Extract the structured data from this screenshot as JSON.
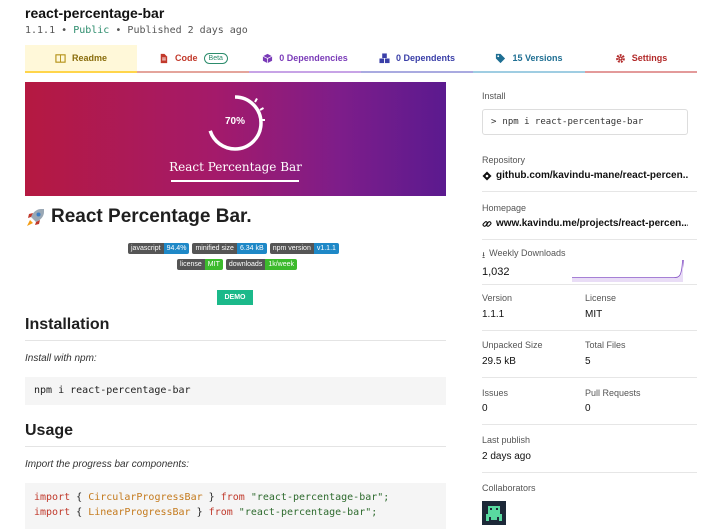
{
  "package": {
    "name": "react-percentage-bar",
    "version": "1.1.1",
    "sep1": "•",
    "visibility": "Public",
    "sep2": "•",
    "published": "Published 2 days ago"
  },
  "tabs": [
    {
      "label": "Readme",
      "icon": "readme-icon"
    },
    {
      "label": "Code",
      "icon": "code-icon",
      "badge": "Beta"
    },
    {
      "label": "0 Dependencies",
      "icon": "box-icon"
    },
    {
      "label": "0 Dependents",
      "icon": "boxes-icon"
    },
    {
      "label": "15 Versions",
      "icon": "tag-icon"
    },
    {
      "label": "Settings",
      "icon": "gear-icon"
    }
  ],
  "readme": {
    "banner": {
      "percent_label": "70%",
      "progress": 0.7,
      "title": "React Percentage Bar"
    },
    "heading": "React Percentage Bar.",
    "badges_row1": [
      {
        "label": "javascript",
        "value": "94.4%",
        "color": "#1e88c7"
      },
      {
        "label": "minified size",
        "value": "6.34 kB",
        "color": "#1e88c7"
      },
      {
        "label": "npm version",
        "value": "v1.1.1",
        "color": "#1e88c7"
      }
    ],
    "badges_row2": [
      {
        "label": "license",
        "value": "MIT",
        "color": "#3cba2c"
      },
      {
        "label": "downloads",
        "value": "1k/week",
        "color": "#3cba2c"
      }
    ],
    "demo_label": "DEMO",
    "installation": {
      "heading": "Installation",
      "note": "Install with npm:",
      "command": "npm i react-percentage-bar"
    },
    "usage": {
      "heading": "Usage",
      "note": "Import the progress bar components:",
      "lines": [
        {
          "kw": "import",
          "open": "{",
          "name": "CircularProgressBar",
          "close": "}",
          "from": "from",
          "module": "\"react-percentage-bar\";"
        },
        {
          "kw": "import",
          "open": "{",
          "name": "LinearProgressBar",
          "close": "}",
          "from": "from",
          "module": "\"react-percentage-bar\";"
        }
      ]
    }
  },
  "sidebar": {
    "install": {
      "label": "Install",
      "prompt": ">",
      "command": "npm i react-percentage-bar"
    },
    "repository": {
      "label": "Repository",
      "value": "github.com/kavindu-mane/react-percen..."
    },
    "homepage": {
      "label": "Homepage",
      "value": "www.kavindu.me/projects/react-percen..."
    },
    "weekly_downloads": {
      "label": "Weekly Downloads",
      "value": "1,032",
      "sparkline_color": "#8956c7"
    },
    "version": {
      "label": "Version",
      "value": "1.1.1"
    },
    "license": {
      "label": "License",
      "value": "MIT"
    },
    "unpacked_size": {
      "label": "Unpacked Size",
      "value": "29.5 kB"
    },
    "total_files": {
      "label": "Total Files",
      "value": "5"
    },
    "issues": {
      "label": "Issues",
      "value": "0"
    },
    "pull_requests": {
      "label": "Pull Requests",
      "value": "0"
    },
    "last_publish": {
      "label": "Last publish",
      "value": "2 days ago"
    },
    "collaborators": {
      "label": "Collaborators"
    }
  }
}
